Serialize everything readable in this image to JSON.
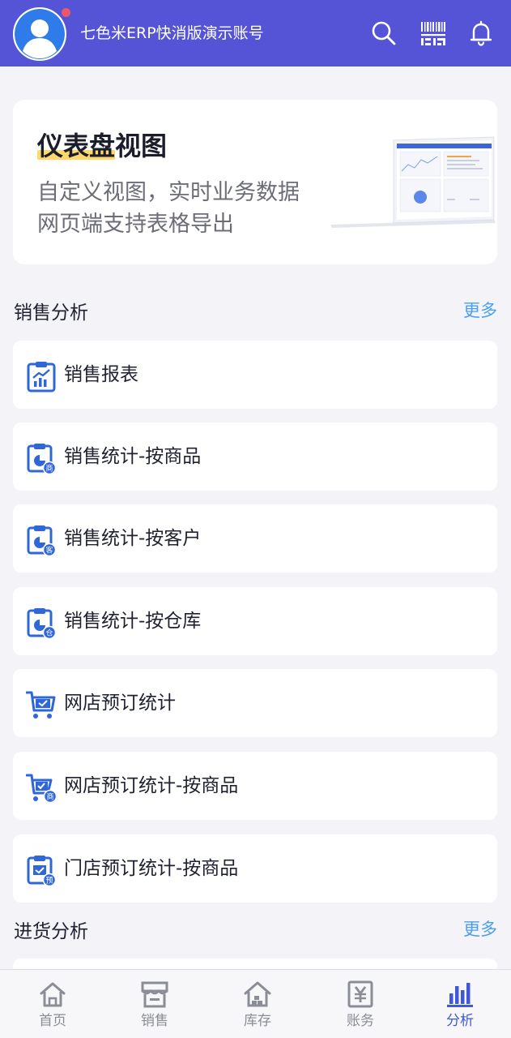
{
  "header": {
    "account_name": "七色米ERP快消版演示账号",
    "icons": [
      "search-icon",
      "barcode-scan-icon",
      "bell-icon"
    ],
    "colors": {
      "background": "#5553d6",
      "notification_dot": "#f0566b"
    }
  },
  "banner": {
    "title": "仪表盘视图",
    "line1": "自定义视图，实时业务数据",
    "line2": "网页端支持表格导出",
    "highlight_color": "#ffd86b"
  },
  "sales_section": {
    "title": "销售分析",
    "more": "更多",
    "items": [
      {
        "label": "销售报表",
        "icon": "report-chart-icon"
      },
      {
        "label": "销售统计-按商品",
        "icon": "stats-by-product-icon",
        "badge": "商"
      },
      {
        "label": "销售统计-按客户",
        "icon": "stats-by-customer-icon",
        "badge": "客"
      },
      {
        "label": "销售统计-按仓库",
        "icon": "stats-by-warehouse-icon",
        "badge": "仓"
      },
      {
        "label": "网店预订统计",
        "icon": "cart-icon"
      },
      {
        "label": "网店预订统计-按商品",
        "icon": "cart-by-product-icon",
        "badge": "商"
      },
      {
        "label": "门店预订统计-按商品",
        "icon": "store-booking-icon",
        "badge": "预"
      }
    ]
  },
  "purchase_section": {
    "title": "进货分析",
    "more": "更多"
  },
  "tabbar": {
    "tabs": [
      {
        "label": "首页",
        "icon": "home-icon"
      },
      {
        "label": "销售",
        "icon": "shop-icon"
      },
      {
        "label": "库存",
        "icon": "warehouse-icon"
      },
      {
        "label": "账务",
        "icon": "yuan-ledger-icon"
      },
      {
        "label": "分析",
        "icon": "bar-chart-icon",
        "active": true
      }
    ],
    "colors": {
      "active": "#3f58d8",
      "inactive": "#8a8c96"
    }
  },
  "colors": {
    "accent_link": "#4a9ff2",
    "icon_blue": "#2f67d8"
  }
}
